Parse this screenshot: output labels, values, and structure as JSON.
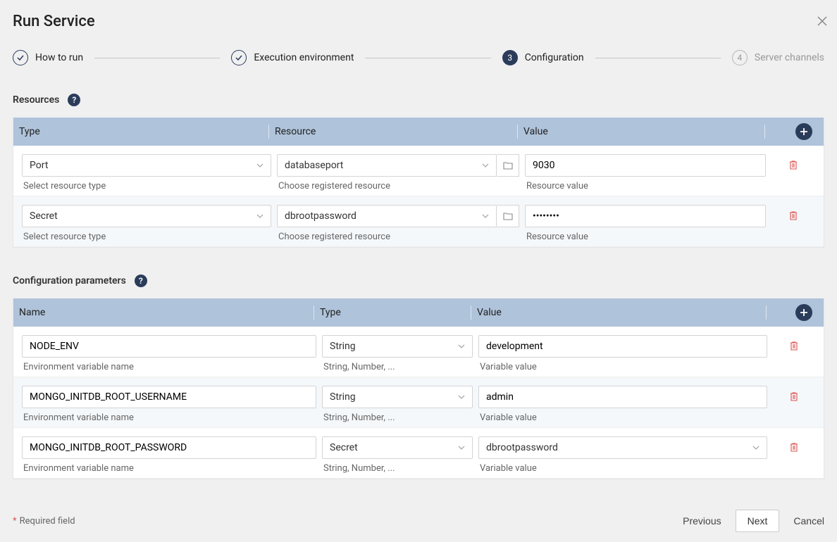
{
  "title": "Run Service",
  "steps": [
    {
      "label": "How to run",
      "status": "done"
    },
    {
      "label": "Execution environment",
      "status": "done"
    },
    {
      "label": "Configuration",
      "num": "3",
      "status": "active"
    },
    {
      "label": "Server channels",
      "num": "4",
      "status": "future"
    }
  ],
  "resources": {
    "section_title": "Resources",
    "cols": {
      "type": "Type",
      "resource": "Resource",
      "value": "Value"
    },
    "hints": {
      "type": "Select resource type",
      "resource": "Choose registered resource",
      "value": "Resource value"
    },
    "rows": [
      {
        "type": "Port",
        "resource": "databaseport",
        "value": "9030",
        "masked": false
      },
      {
        "type": "Secret",
        "resource": "dbrootpassword",
        "value": "••••••••",
        "masked": true
      }
    ]
  },
  "params": {
    "section_title": "Configuration parameters",
    "cols": {
      "name": "Name",
      "type": "Type",
      "value": "Value"
    },
    "hints": {
      "name": "Environment variable name",
      "type": "String, Number, ...",
      "value": "Variable value"
    },
    "rows": [
      {
        "name": "NODE_ENV",
        "type": "String",
        "value": "development",
        "value_kind": "text"
      },
      {
        "name": "MONGO_INITDB_ROOT_USERNAME",
        "type": "String",
        "value": "admin",
        "value_kind": "text"
      },
      {
        "name": "MONGO_INITDB_ROOT_PASSWORD",
        "type": "Secret",
        "value": "dbrootpassword",
        "value_kind": "select"
      }
    ]
  },
  "footer": {
    "required": "Required field",
    "previous": "Previous",
    "next": "Next",
    "cancel": "Cancel"
  }
}
